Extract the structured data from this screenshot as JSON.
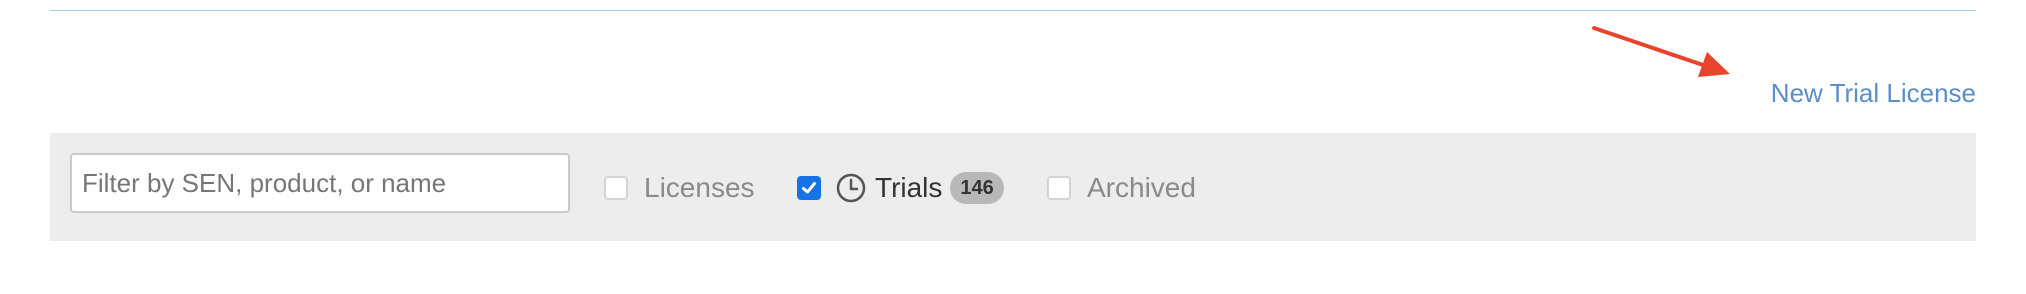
{
  "header": {
    "new_trial_link": "New Trial License",
    "link_color": "#5b8ec9",
    "annotation_arrow_color": "#e8432b"
  },
  "filters": {
    "search": {
      "placeholder": "Filter by SEN, product, or name",
      "value": ""
    },
    "options": {
      "licenses": {
        "label": "Licenses",
        "checked": false
      },
      "trials": {
        "label": "Trials",
        "checked": true,
        "count": "146",
        "icon": "clock-icon"
      },
      "archived": {
        "label": "Archived",
        "checked": false
      }
    },
    "checkbox_color": "#1672e6"
  }
}
